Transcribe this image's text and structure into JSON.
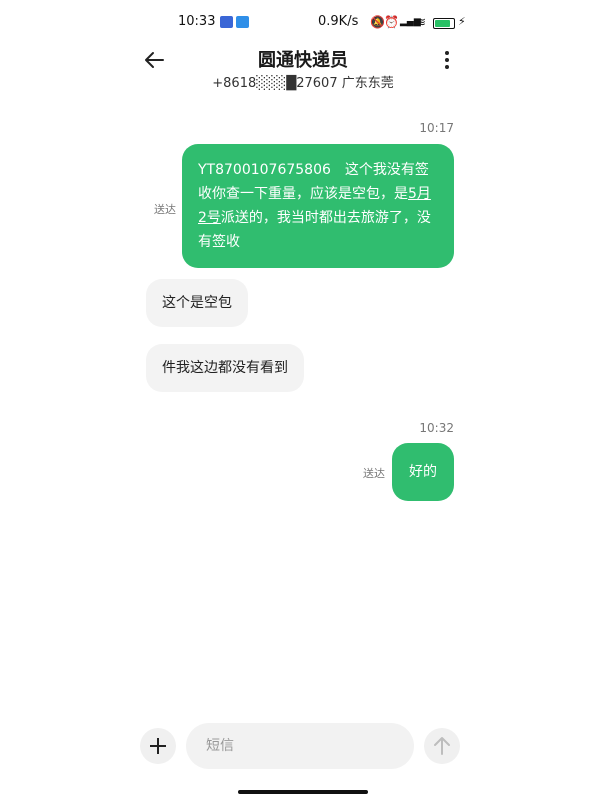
{
  "status_bar": {
    "time": "10:33",
    "network_speed": "0.9K/s",
    "battery_level": "71"
  },
  "header": {
    "title": "圆通快递员",
    "subtitle": "+8618░░░█27607 广东东莞"
  },
  "messages": [
    {
      "timestamp": "10:17"
    },
    {
      "text_part1": "YT8700107675806　这个我没有签收你查一下重量，应该是空包，是",
      "date_link": "5月2号",
      "text_part2": "派送的，我当时都出去旅游了，没有签收",
      "delivered": "送达"
    },
    {
      "text": "这个是空包"
    },
    {
      "text": "件我这边都没有看到"
    },
    {
      "timestamp": "10:32"
    },
    {
      "text": "好的",
      "delivered": "送达"
    }
  ],
  "composer": {
    "placeholder": "短信"
  },
  "colors": {
    "outgoing_bubble": "#30bd6f",
    "incoming_bubble": "#f3f3f3"
  }
}
